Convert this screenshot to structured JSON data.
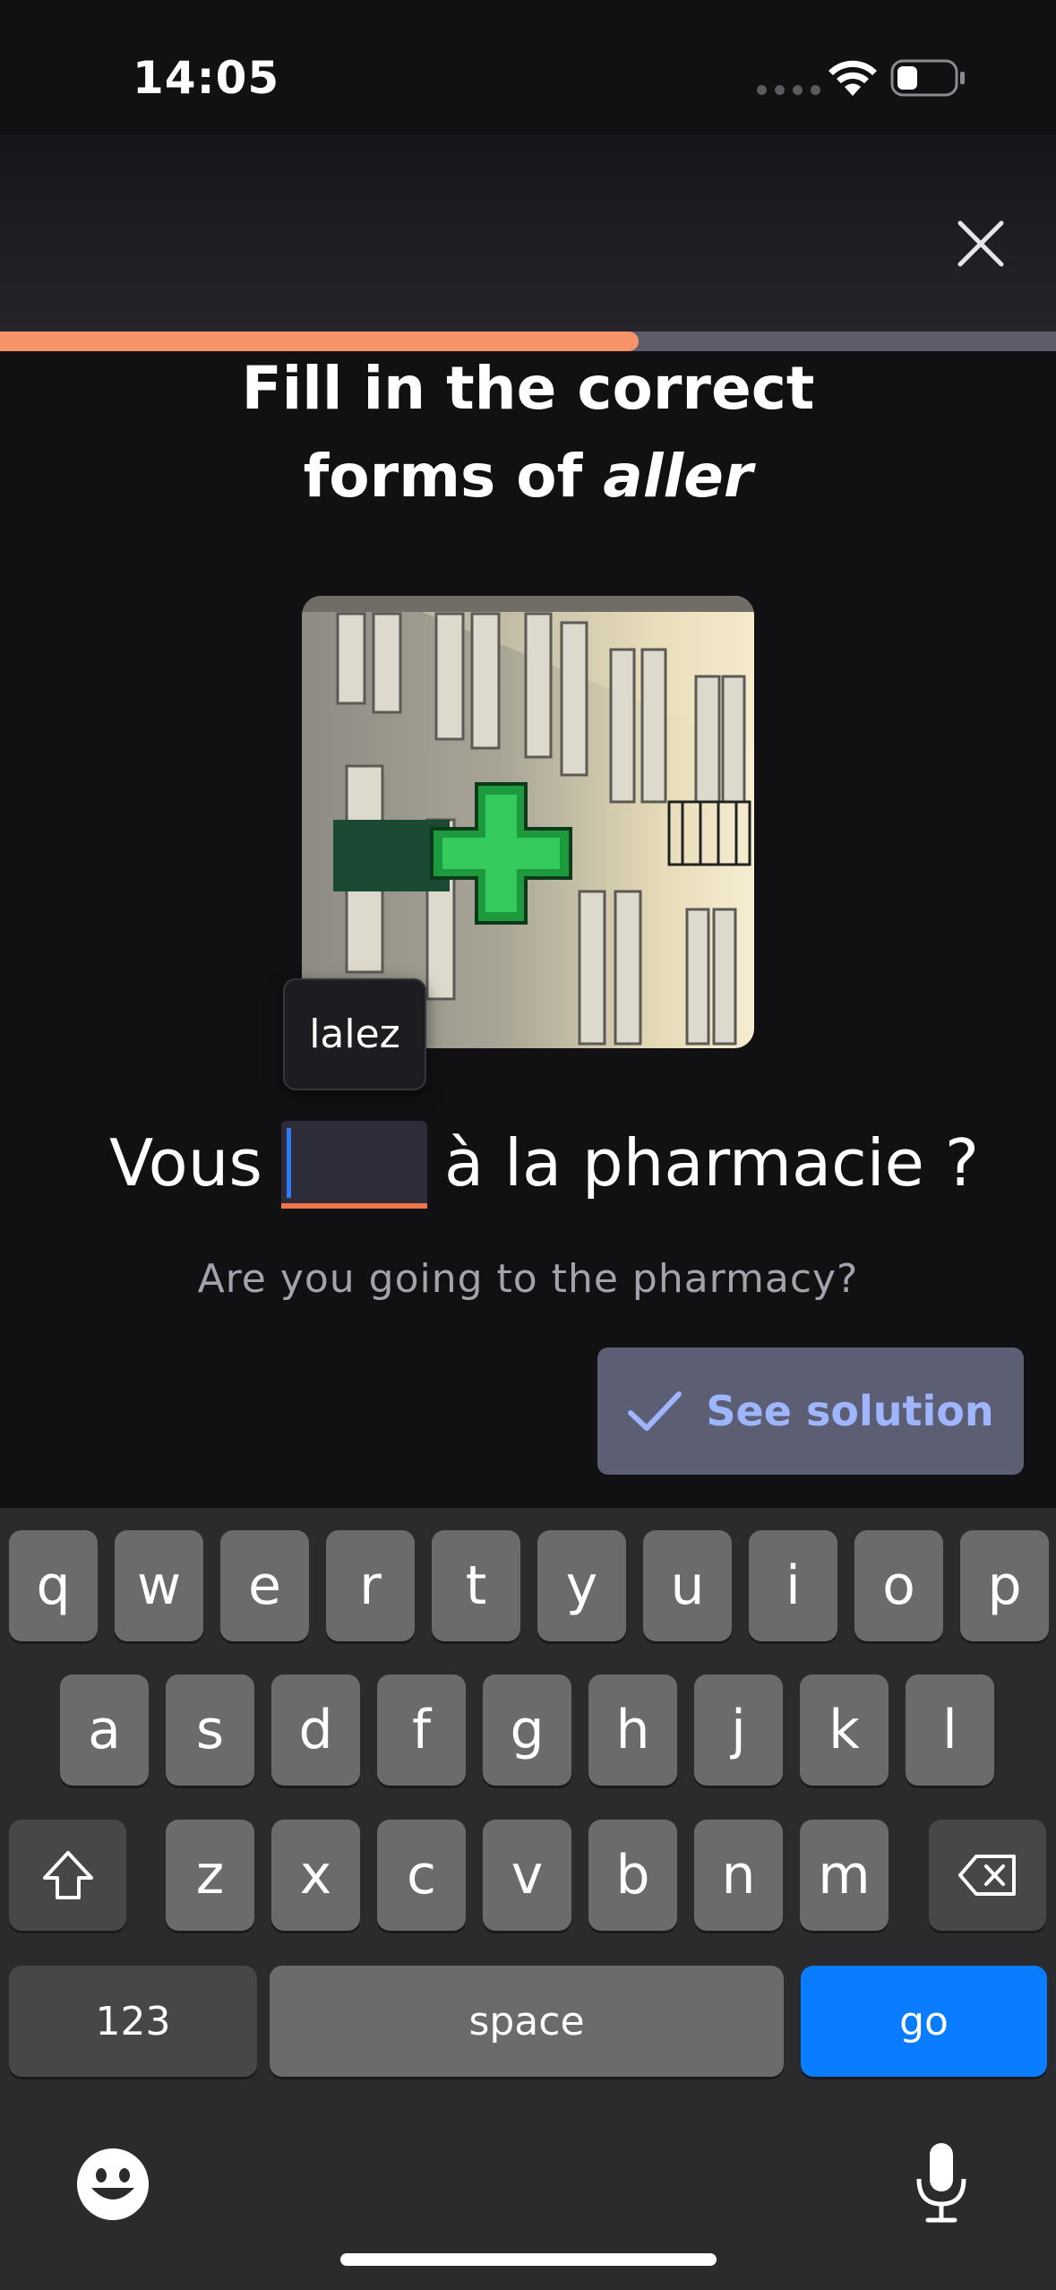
{
  "status_bar": {
    "time": "14:05"
  },
  "progress": {
    "fraction": 0.605,
    "color": "#f79368"
  },
  "prompt": {
    "title_line1": "Fill in the correct",
    "title_line2_prefix": "forms of ",
    "title_verb": "aller"
  },
  "image": {
    "description": "pharmacy-cross-sign"
  },
  "exercise": {
    "suggestion": "lalez",
    "sentence_start": "Vous",
    "blank_value": "",
    "sentence_end": "à la pharmacie ?",
    "translation": "Are you going to the pharmacy?"
  },
  "actions": {
    "see_solution_label": "See solution"
  },
  "keyboard": {
    "row1": [
      "q",
      "w",
      "e",
      "r",
      "t",
      "y",
      "u",
      "i",
      "o",
      "p"
    ],
    "row2": [
      "a",
      "s",
      "d",
      "f",
      "g",
      "h",
      "j",
      "k",
      "l"
    ],
    "row3": [
      "z",
      "x",
      "c",
      "v",
      "b",
      "n",
      "m"
    ],
    "numbers_label": "123",
    "space_label": "space",
    "go_label": "go"
  },
  "colors": {
    "accent": "#f79368",
    "keyboard_go": "#0a7cff",
    "button": "#5c5f73",
    "button_text": "#9fb6ff"
  }
}
